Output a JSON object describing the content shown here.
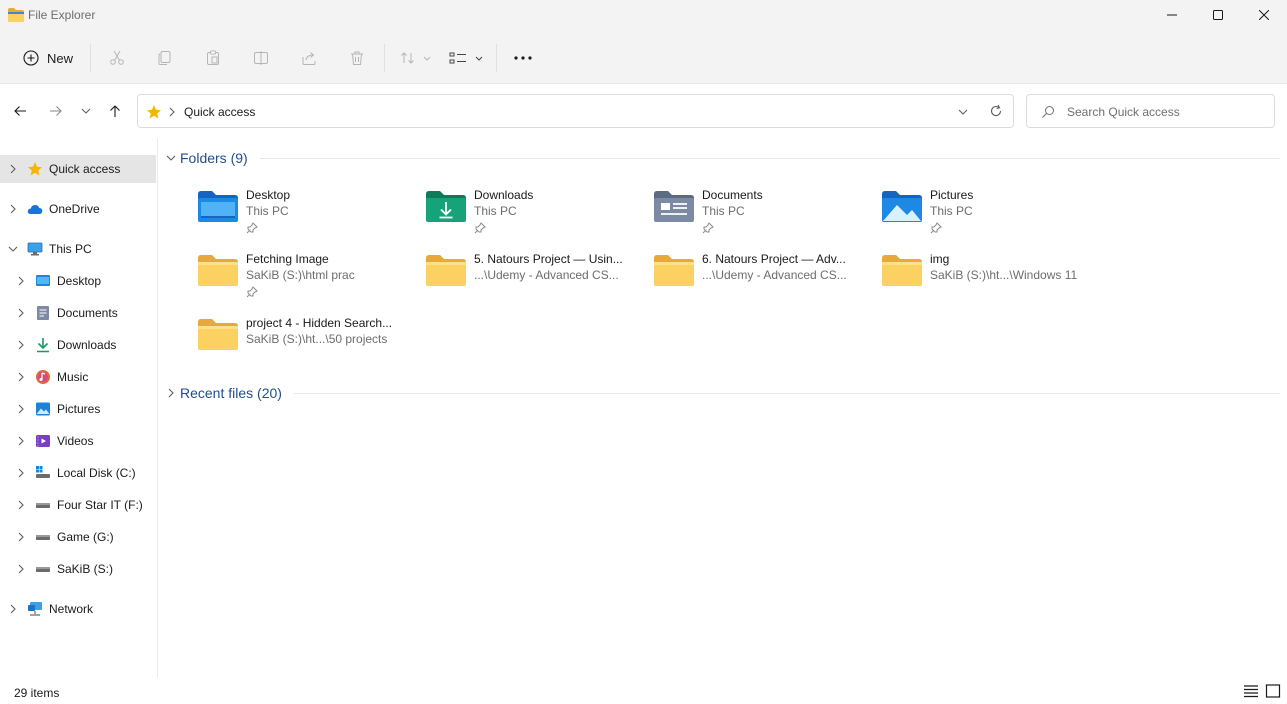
{
  "window": {
    "title": "File Explorer",
    "icon": "folder-icon"
  },
  "commandbar": {
    "new_label": "New",
    "more_label": "•••"
  },
  "address": {
    "location": "Quick access",
    "search_placeholder": "Search Quick access"
  },
  "sidebar": {
    "items": [
      {
        "label": "Quick access",
        "icon": "star-icon",
        "level": 0,
        "selected": true
      },
      {
        "label": "OneDrive",
        "icon": "cloud-icon",
        "level": 0
      },
      {
        "label": "This PC",
        "icon": "computer-icon",
        "level": 0,
        "expanded": true
      },
      {
        "label": "Desktop",
        "icon": "desktop-icon",
        "level": 1
      },
      {
        "label": "Documents",
        "icon": "documents-icon",
        "level": 1
      },
      {
        "label": "Downloads",
        "icon": "download-icon",
        "level": 1
      },
      {
        "label": "Music",
        "icon": "music-icon",
        "level": 1
      },
      {
        "label": "Pictures",
        "icon": "pictures-icon",
        "level": 1
      },
      {
        "label": "Videos",
        "icon": "videos-icon",
        "level": 1
      },
      {
        "label": "Local Disk (C:)",
        "icon": "drive-c-icon",
        "level": 1
      },
      {
        "label": "Four Star IT (F:)",
        "icon": "drive-icon",
        "level": 1
      },
      {
        "label": "Game (G:)",
        "icon": "drive-icon",
        "level": 1
      },
      {
        "label": "SaKiB (S:)",
        "icon": "drive-icon",
        "level": 1
      },
      {
        "label": "Network",
        "icon": "network-icon",
        "level": 0
      }
    ]
  },
  "main": {
    "folders_header": "Folders (9)",
    "recent_header": "Recent files (20)",
    "folders": [
      {
        "name": "Desktop",
        "location": "This PC",
        "pinned": true,
        "icon": "desktop-folder-icon"
      },
      {
        "name": "Downloads",
        "location": "This PC",
        "pinned": true,
        "icon": "downloads-folder-icon"
      },
      {
        "name": "Documents",
        "location": "This PC",
        "pinned": true,
        "icon": "documents-folder-icon"
      },
      {
        "name": "Pictures",
        "location": "This PC",
        "pinned": true,
        "icon": "pictures-folder-icon"
      },
      {
        "name": "Fetching Image",
        "location": "SaKiB (S:)\\html prac",
        "pinned": true,
        "icon": "folder-icon"
      },
      {
        "name": "5. Natours Project — Usin...",
        "location": "...\\Udemy - Advanced CS...",
        "pinned": false,
        "icon": "folder-icon"
      },
      {
        "name": "6. Natours Project — Adv...",
        "location": "...\\Udemy - Advanced CS...",
        "pinned": false,
        "icon": "folder-icon"
      },
      {
        "name": "img",
        "location": "SaKiB (S:)\\ht...\\Windows 11",
        "pinned": false,
        "icon": "folder-icon"
      },
      {
        "name": "project 4 - Hidden Search...",
        "location": "SaKiB (S:)\\ht...\\50 projects",
        "pinned": false,
        "icon": "folder-icon"
      }
    ]
  },
  "status": {
    "items_count": "29 items"
  },
  "colors": {
    "accent": "#1f4e8c",
    "folder_yellow": "#f8c94a",
    "selected_bg": "#e5e5e5"
  }
}
